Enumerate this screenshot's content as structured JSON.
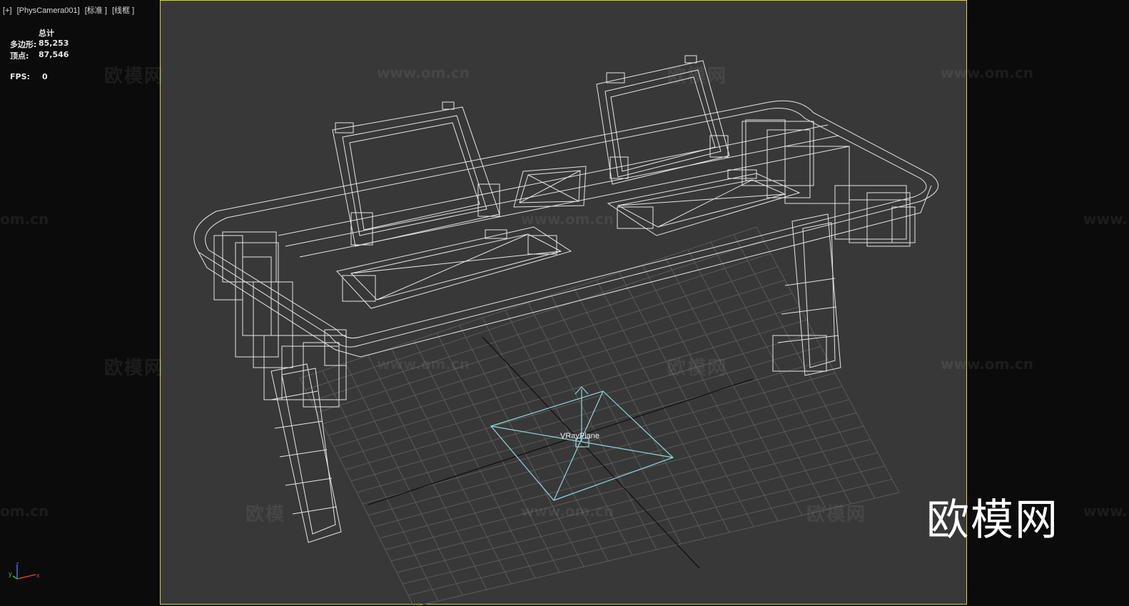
{
  "viewport": {
    "plus": "[+]",
    "camera": "[PhysCamera001]",
    "shading": "[标准 ]",
    "mode": "[线框 ]"
  },
  "stats": {
    "total_label": "总计",
    "poly_label": "多边形:",
    "poly_value": "85,253",
    "vert_label": "顶点:",
    "vert_value": "87,546",
    "fps_label": "FPS:",
    "fps_value": "0"
  },
  "scene": {
    "object_label": "VRayPlane"
  },
  "watermarks": {
    "url": "www.om.cn",
    "url_cut": "om.cn",
    "url_cut_right": "www.",
    "brand": "欧模网",
    "brand_cut": "欧模"
  },
  "axis": {
    "x": "x",
    "y": "y",
    "z": "z"
  },
  "colors": {
    "viewport_bg": "#383838",
    "frame": "#d8cf3a",
    "wire": "#e6e6e6",
    "grid": "#5a5a5a",
    "vray_plane": "#8fd8d8"
  }
}
